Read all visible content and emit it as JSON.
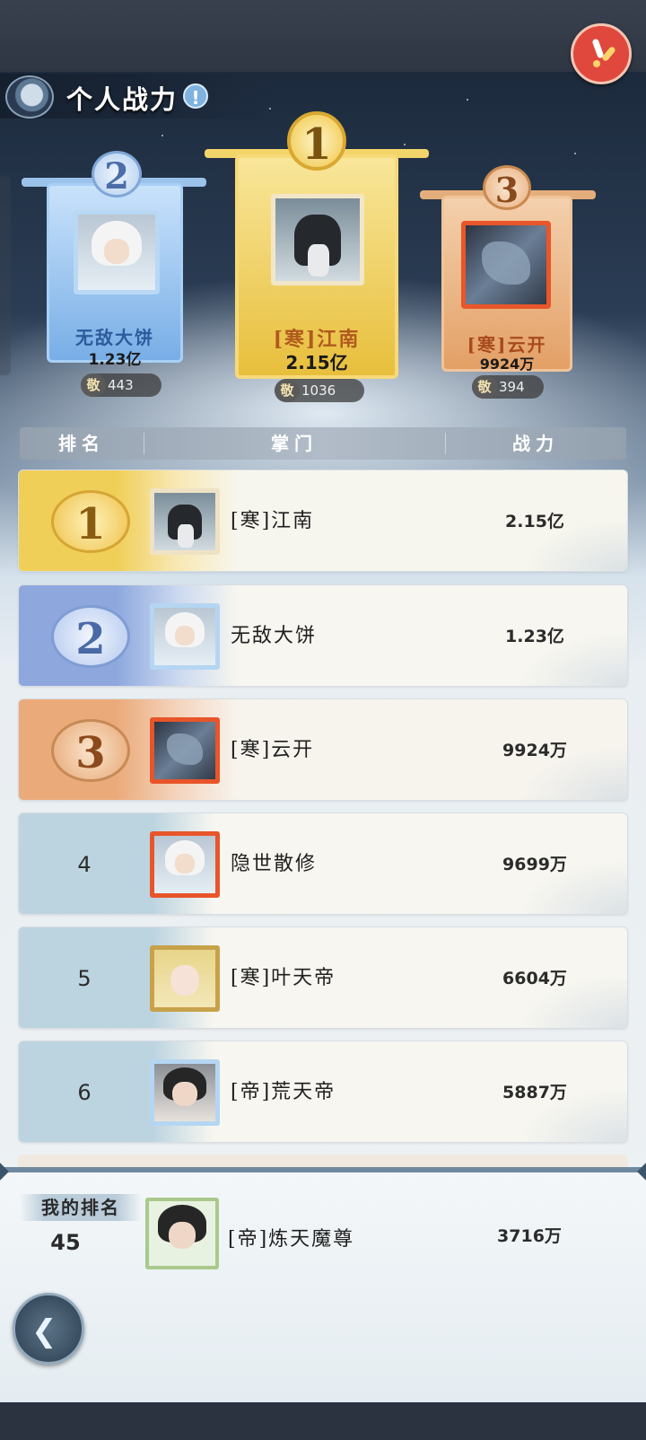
{
  "header": {
    "title": "个人战力",
    "info_icon": "!",
    "close_icon": "close-icon"
  },
  "podium": [
    {
      "rank": "2",
      "name": "无敌大饼",
      "power": "1.23亿",
      "likes_icon": "敬",
      "likes": "443"
    },
    {
      "rank": "1",
      "name": "[寒]江南",
      "power": "2.15亿",
      "likes_icon": "敬",
      "likes": "1036"
    },
    {
      "rank": "3",
      "name": "[寒]云开",
      "power": "9924万",
      "likes_icon": "敬",
      "likes": "394"
    }
  ],
  "table": {
    "headers": [
      "排名",
      "掌门",
      "战力"
    ],
    "rows": [
      {
        "rank": "1",
        "name": "[寒]江南",
        "power": "2.15亿"
      },
      {
        "rank": "2",
        "name": "无敌大饼",
        "power": "1.23亿"
      },
      {
        "rank": "3",
        "name": "[寒]云开",
        "power": "9924万"
      },
      {
        "rank": "4",
        "name": "隐世散修",
        "power": "9699万"
      },
      {
        "rank": "5",
        "name": "[寒]叶天帝",
        "power": "6604万"
      },
      {
        "rank": "6",
        "name": "[帝]荒天帝",
        "power": "5887万"
      }
    ]
  },
  "my_rank": {
    "label": "我的排名",
    "rank": "45",
    "name": "[帝]炼天魔尊",
    "power": "3716万"
  },
  "colors": {
    "gold": "#f0cf58",
    "silver": "#8ea8de",
    "bronze": "#ebaa7a",
    "accent_red": "#e0473d"
  }
}
